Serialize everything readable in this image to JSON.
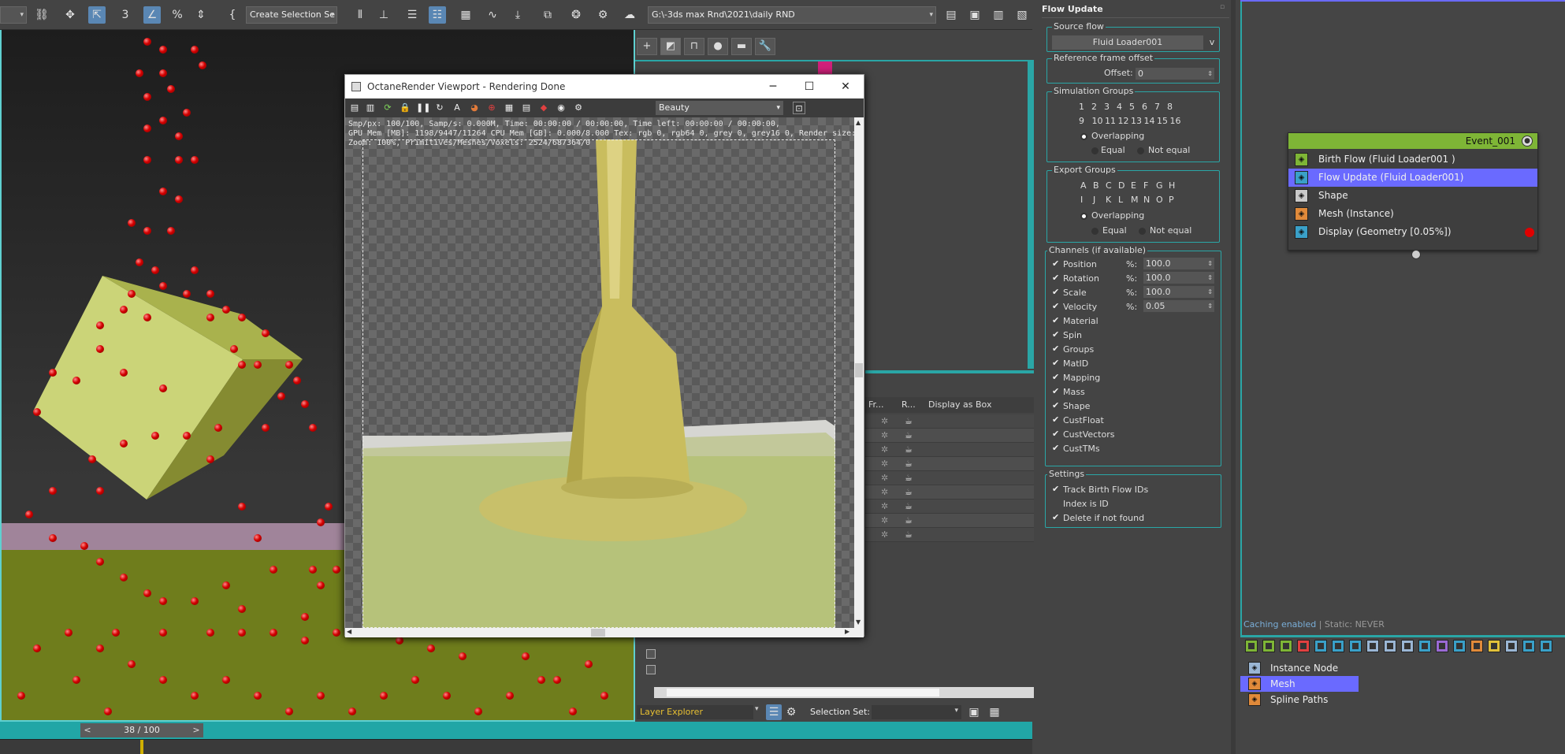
{
  "toolbar": {
    "selection_set": "Create Selection Se",
    "path": "G:\\-3ds max Rnd\\2021\\daily RND",
    "icons": [
      "link-icon",
      "move-icon",
      "select-object-icon",
      "snap-3-icon",
      "angle-snap-icon",
      "percent-snap-icon",
      "spinner-snap-icon",
      "edit-named-sets-icon",
      "mirror-icon",
      "align-icon",
      "scene-explorer-icon",
      "layer-explorer-icon",
      "toggle-ribbon-icon",
      "curve-editor-icon",
      "schematic-view-icon",
      "material-editor-icon",
      "render-setup-icon",
      "render-frame-icon",
      "render-icon"
    ]
  },
  "viewport": {
    "frame": "38 / 100",
    "prev": "<",
    "next": ">"
  },
  "render_window": {
    "title": "OctaneRender Viewport - Rendering Done",
    "pass": "Beauty",
    "stats": [
      "Smp/px: 100/100,   Samp/s: 0.000M,   Time: 00:00:00 / 00:00:00,   Time left: 00:00:00 / 00:00:00,",
      "GPU Mem [MB]: 1198/9447/11264   CPU Mem [GB]: 0.000/8.000   Tex: rgb 0, rgb64 0, grey 0, grey16 0,   Render size: 600 x 600,",
      "Zoom: 100%,   Primitives/Meshes/Voxels: 2524/687364/0"
    ],
    "minimize": "─",
    "maximize": "☐",
    "close": "✕"
  },
  "scene_explorer": {
    "columns": [
      "Fr...",
      "R...",
      "Display as Box"
    ],
    "row_count": 9
  },
  "layer_bar": {
    "explorer": "Layer Explorer",
    "selection_set_label": "Selection Set:"
  },
  "flow_update": {
    "title": "Flow Update",
    "source_flow_label": "Source flow",
    "source_flow_value": "Fluid Loader001",
    "source_flow_btn": "v",
    "ref_frame_label": "Reference frame offset",
    "offset_label": "Offset:",
    "offset_value": "0",
    "sim_groups_label": "Simulation Groups",
    "sim_groups_row1": [
      "1",
      "2",
      "3",
      "4",
      "5",
      "6",
      "7",
      "8"
    ],
    "sim_groups_row2": [
      "9",
      "10",
      "11",
      "12",
      "13",
      "14",
      "15",
      "16"
    ],
    "sim_overlapping": "Overlapping",
    "sim_equal": "Equal",
    "sim_not_equal": "Not equal",
    "export_groups_label": "Export Groups",
    "export_row1": [
      "A",
      "B",
      "C",
      "D",
      "E",
      "F",
      "G",
      "H"
    ],
    "export_row2": [
      "I",
      "J",
      "K",
      "L",
      "M",
      "N",
      "O",
      "P"
    ],
    "exp_overlapping": "Overlapping",
    "exp_equal": "Equal",
    "exp_not_equal": "Not equal",
    "channels_label": "Channels (if available)",
    "channels": [
      {
        "name": "Position",
        "checked": true,
        "pct": "100.0"
      },
      {
        "name": "Rotation",
        "checked": true,
        "pct": "100.0"
      },
      {
        "name": "Scale",
        "checked": true,
        "pct": "100.0"
      },
      {
        "name": "Velocity",
        "checked": true,
        "pct": "0.05"
      },
      {
        "name": "Material",
        "checked": true
      },
      {
        "name": "Spin",
        "checked": true
      },
      {
        "name": "Groups",
        "checked": true
      },
      {
        "name": "MatID",
        "checked": true
      },
      {
        "name": "Mapping",
        "checked": true
      },
      {
        "name": "Mass",
        "checked": true
      },
      {
        "name": "Shape",
        "checked": true
      },
      {
        "name": "CustFloat",
        "checked": true
      },
      {
        "name": "CustVectors",
        "checked": true
      },
      {
        "name": "CustTMs",
        "checked": true
      }
    ],
    "pct_label": "%:",
    "settings_label": "Settings",
    "settings": [
      {
        "name": "Track Birth Flow IDs",
        "checked": true
      },
      {
        "name": "Index is ID",
        "checked": false
      },
      {
        "name": "Delete if not found",
        "checked": true
      }
    ]
  },
  "node_editor": {
    "event_title": "Event_001",
    "operators": [
      {
        "label": "Birth Flow (Fluid Loader001 )",
        "color": "#7eb536",
        "selected": false
      },
      {
        "label": "Flow Update (Fluid Loader001)",
        "color": "#3aa0c8",
        "selected": true
      },
      {
        "label": "Shape",
        "color": "#c9c9c9",
        "selected": false
      },
      {
        "label": "Mesh (Instance)",
        "color": "#e08a3a",
        "selected": false
      },
      {
        "label": "Display (Geometry [0.05%])",
        "color": "#3aa0c8",
        "selected": false
      }
    ],
    "caching": "Caching enabled",
    "static": " | Static: NEVER",
    "depot": [
      {
        "label": "Instance Node",
        "color": "#9ab6d4",
        "selected": false
      },
      {
        "label": "Mesh",
        "color": "#e08a3a",
        "selected": true
      },
      {
        "label": "Spline Paths",
        "color": "#e08a3a",
        "selected": false
      }
    ],
    "accent": "#6a6aff"
  }
}
